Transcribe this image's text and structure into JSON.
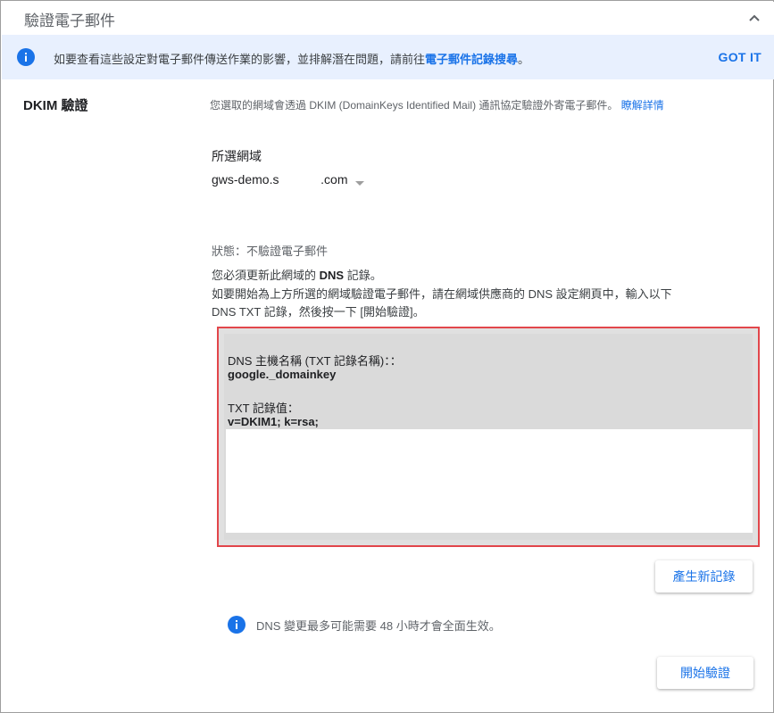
{
  "header": {
    "title": "驗證電子郵件",
    "collapse_icon": "chevron-up-icon"
  },
  "banner": {
    "icon": "info-icon",
    "text": "如要查看這些設定對電子郵件傳送作業的影響，並排解潛在問題，請前往",
    "link_label": "電子郵件記錄搜尋",
    "text_suffix": "。",
    "dismiss_label": "GOT IT"
  },
  "dkim": {
    "section_label": "DKIM 驗證",
    "description": "您選取的網域會透過 DKIM (DomainKeys Identified Mail) 通訊協定驗證外寄電子郵件。",
    "learn_more": "瞭解詳情",
    "domain_label": "所選網域",
    "domain_value": "gws-demo.s            .com",
    "status": "狀態：不驗證電子郵件",
    "para1_prefix": "您必須更新此網域的 ",
    "para1_bold": "DNS",
    "para1_suffix": " 記錄。",
    "para2": "如要開始為上方所選的網域驗證電子郵件，請在網域供應商的 DNS 設定網頁中，輸入以下",
    "para3": "DNS TXT 記錄，然後按一下 [開始驗證]。",
    "record": {
      "host_label": "DNS 主機名稱 (TXT 記錄名稱)：：",
      "host_value": "google._domainkey",
      "txt_label": "TXT 記錄值：",
      "txt_value": "v=DKIM1; k=rsa;"
    },
    "generate_button": "產生新記錄",
    "note": "DNS 變更最多可能需要 48 小時才會全面生效。",
    "start_button": "開始驗證"
  },
  "colors": {
    "accent": "#1a73e8",
    "banner_bg": "#e8f0fe",
    "highlight_border": "#e2464b"
  }
}
